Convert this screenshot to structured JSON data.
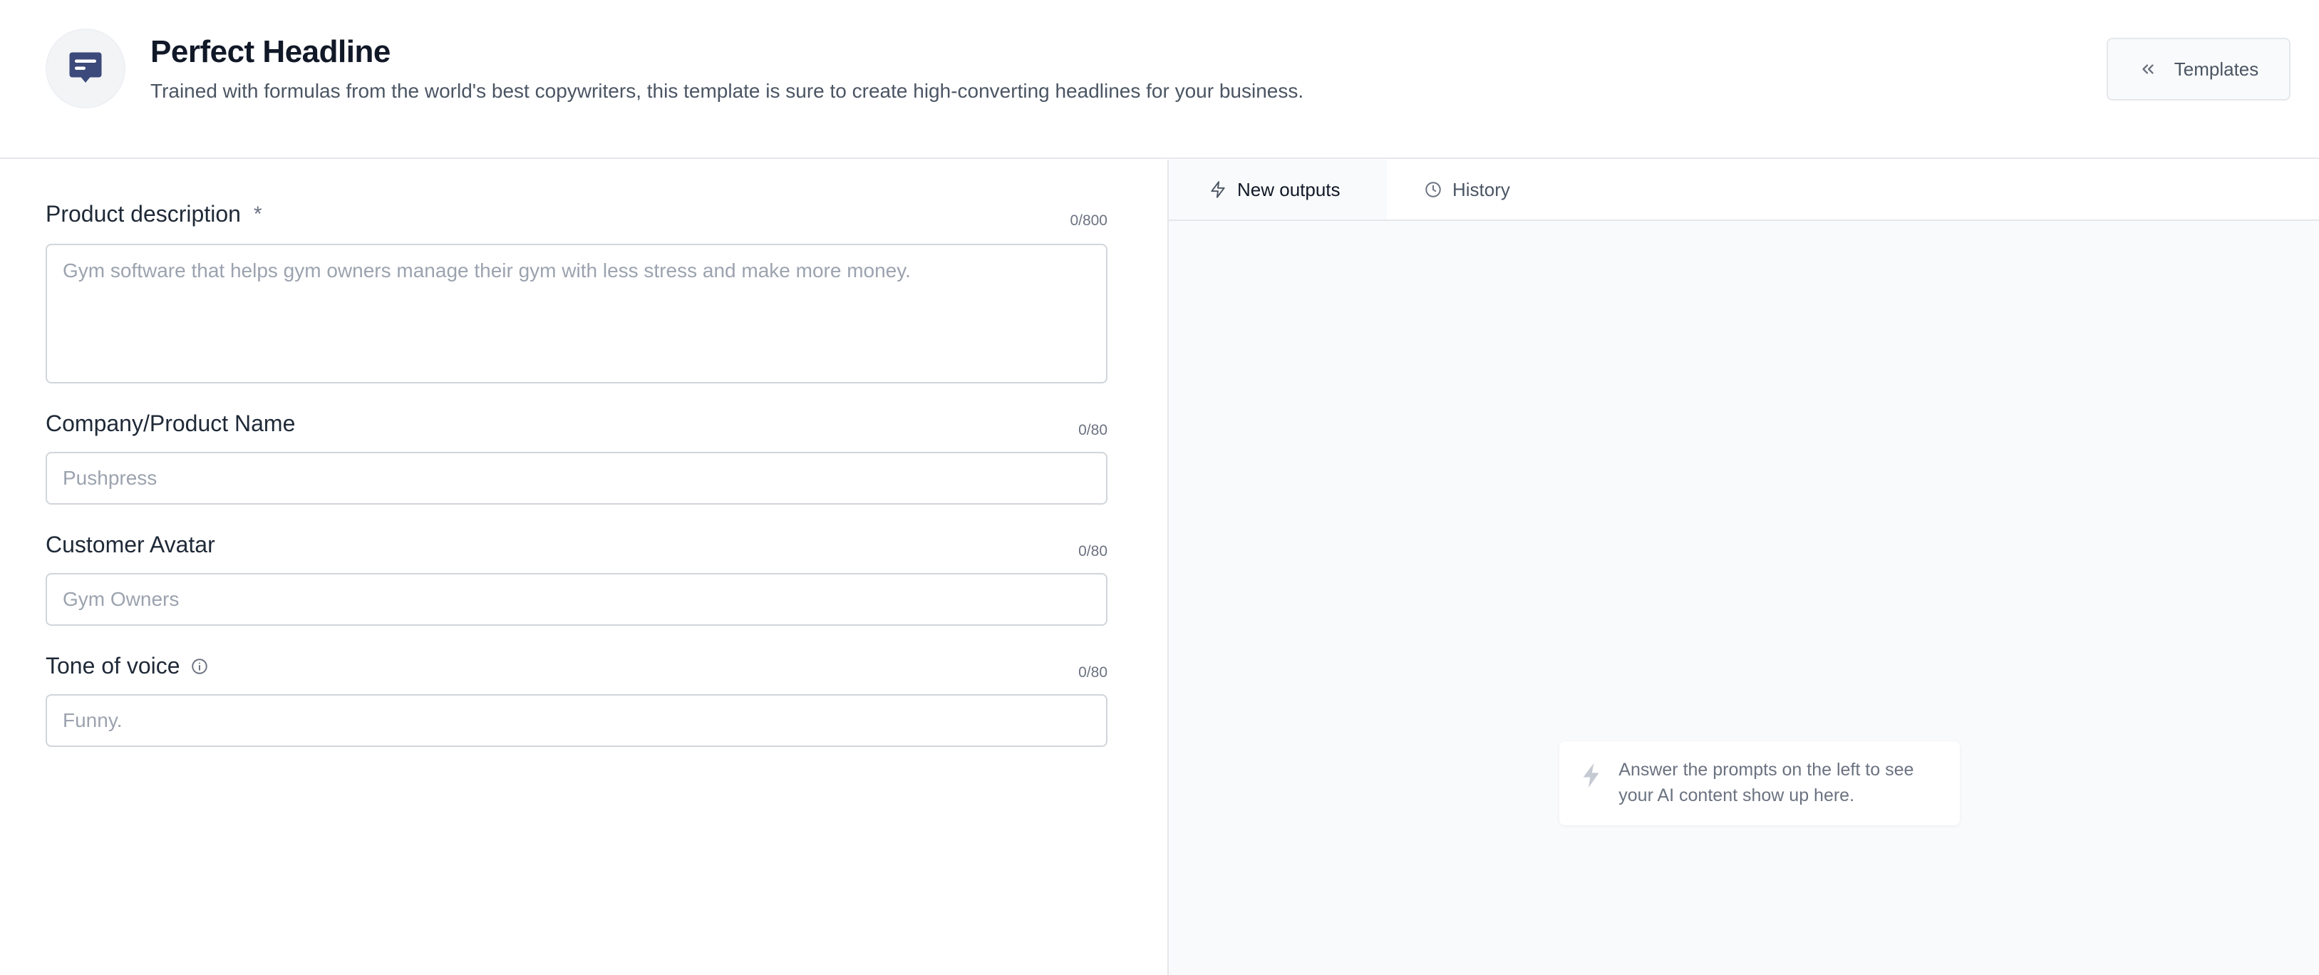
{
  "header": {
    "icon": "chat-message-icon",
    "title": "Perfect Headline",
    "subtitle": "Trained with formulas from the world's best copywriters, this template is sure to create high-converting headlines for your business.",
    "templates_label": "Templates"
  },
  "form": {
    "product_description": {
      "label": "Product description",
      "required_mark": "*",
      "counter": "0/800",
      "placeholder": "Gym software that helps gym owners manage their gym with less stress and make more money."
    },
    "company_name": {
      "label": "Company/Product Name",
      "counter": "0/80",
      "placeholder": "Pushpress"
    },
    "customer_avatar": {
      "label": "Customer Avatar",
      "counter": "0/80",
      "placeholder": "Gym Owners"
    },
    "tone_of_voice": {
      "label": "Tone of voice",
      "counter": "0/80",
      "placeholder": "Funny."
    }
  },
  "output": {
    "tabs": [
      {
        "label": "New outputs",
        "icon": "bolt-icon"
      },
      {
        "label": "History",
        "icon": "clock-icon"
      }
    ],
    "empty_message": "Answer the prompts on the left to see your AI content show up here."
  },
  "colors": {
    "brand_icon": "#3b4a7a",
    "border": "#d1d5db",
    "panel_bg": "#f9fafb"
  }
}
